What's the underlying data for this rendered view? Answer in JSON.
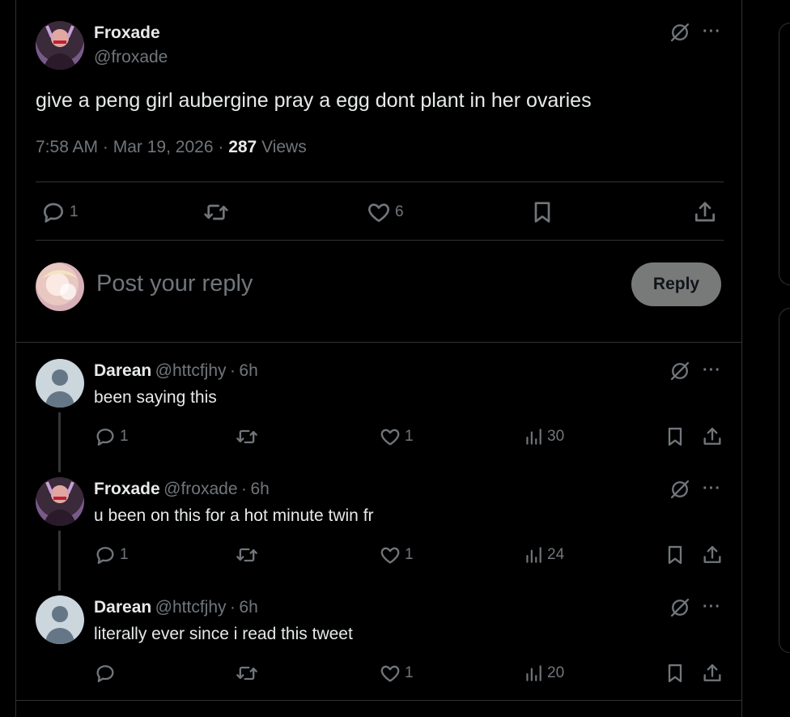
{
  "colors": {
    "bg": "#000000",
    "text": "#e7e9ea",
    "muted": "#71767b",
    "border": "#2f3336",
    "reply_btn": "#787a7a"
  },
  "post": {
    "author_name": "Froxade",
    "author_handle": "@froxade",
    "text": "give a peng girl aubergine pray a egg dont plant in her ovaries",
    "time": "7:58 AM",
    "date": "Mar 19, 2026",
    "views_count": "287",
    "views_label": "Views",
    "replies": "1",
    "likes": "6"
  },
  "composer": {
    "placeholder": "Post your reply",
    "reply_label": "Reply"
  },
  "replies": [
    {
      "name": "Darean",
      "handle": "@httcfjhy",
      "time": "6h",
      "text": "been saying this",
      "replies": "1",
      "retweets": "",
      "likes": "1",
      "views": "30"
    },
    {
      "name": "Froxade",
      "handle": "@froxade",
      "time": "6h",
      "text": "u been on this for a hot minute twin fr",
      "replies": "1",
      "retweets": "",
      "likes": "1",
      "views": "24"
    },
    {
      "name": "Darean",
      "handle": "@httcfjhy",
      "time": "6h",
      "text": "literally ever since i read this tweet",
      "replies": "",
      "retweets": "",
      "likes": "1",
      "views": "20"
    }
  ],
  "separators": {
    "dot": "·",
    "more": "···"
  },
  "icons": [
    "grok-icon",
    "more-icon",
    "reply-icon",
    "retweet-icon",
    "like-icon",
    "bookmark-icon",
    "share-icon",
    "views-icon"
  ]
}
